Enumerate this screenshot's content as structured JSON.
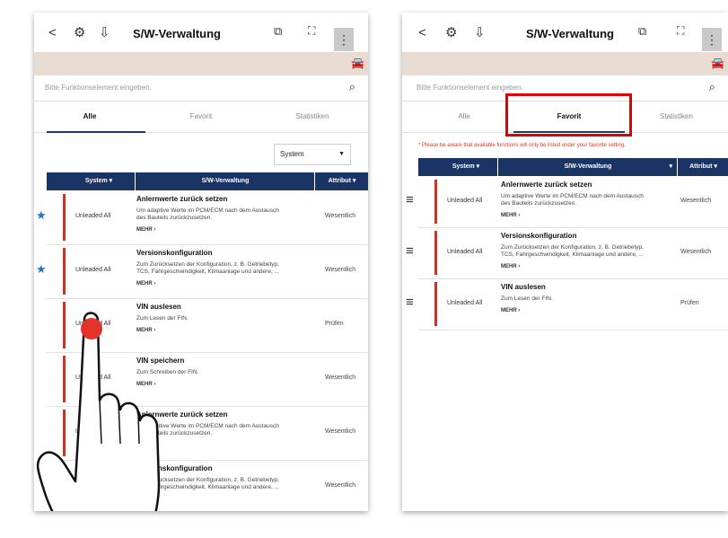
{
  "left": {
    "header": {
      "back": "<",
      "title": "S/W-Verwaltung",
      "menu": "⋮"
    },
    "search_placeholder": "Bitte Funktionselement eingeben.",
    "tabs": [
      "Alle",
      "Favorit",
      "Statistiken"
    ],
    "system_dropdown": "System",
    "table_headers": {
      "system": "System",
      "sw": "S/W-Verwaltung",
      "attr": "Attribut"
    },
    "rows": [
      {
        "system": "Unleaded All",
        "title": "Anlernwerte zurück setzen",
        "desc1": "Um adaptive Werte im PCM/ECM nach dem Austausch",
        "desc2": "des Bauteils zurückzusetzen.",
        "more": "MEHR ›",
        "attr": "Wesentlich",
        "star": true
      },
      {
        "system": "Unleaded All",
        "title": "Versionskonfiguration",
        "desc1": "Zum Zurücksetzen der Konfiguration, z. B. Getriebetyp,",
        "desc2": "TCS, Fahrgeschwindigkeit, Klimaanlage und andere, ...",
        "more": "MEHR ›",
        "attr": "Wesentlich",
        "star": true
      },
      {
        "system": "Unleaded All",
        "title": "VIN auslesen",
        "desc1": "Zum Lesen der FIN.",
        "desc2": "",
        "more": "MEHR ›",
        "attr": "Prüfen",
        "star": false
      },
      {
        "system": "Unleaded All",
        "title": "VIN speichern",
        "desc1": "Zum Schreiben der FIN.",
        "desc2": "",
        "more": "MEHR ›",
        "attr": "Wesentlich",
        "star": false
      },
      {
        "system": "Unleaded All",
        "title": "Anlernwerte zurück setzen",
        "desc1": "Um adaptive Werte im PCM/ECM nach dem Austausch",
        "desc2": "des Bauteils zurückzusetzen.",
        "more": "MEHR ›",
        "attr": "Wesentlich",
        "star": false
      },
      {
        "system": "Unleaded All",
        "title": "Versionskonfiguration",
        "desc1": "Zum Zurücksetzen der Konfiguration, z. B. Getriebetyp,",
        "desc2": "TCS, Fahrgeschwindigkeit, Klimaanlage und andere, ...",
        "more": "MEHR ›",
        "attr": "Wesentlich",
        "star": false
      }
    ]
  },
  "right": {
    "header": {
      "back": "<",
      "title": "S/W-Verwaltung",
      "menu": "⋮"
    },
    "search_placeholder": "Bitte Funktionselement eingeben.",
    "tabs": [
      "Alle",
      "Favorit",
      "Statistiken"
    ],
    "notice": "* Please be aware that available functions will only be listed under your favorite setting.",
    "table_headers": {
      "system": "System",
      "sw": "S/W-Verwaltung",
      "attr": "Attribut"
    },
    "rows": [
      {
        "system": "Unleaded All",
        "title": "Anlernwerte zurück setzen",
        "desc1": "Um adaptive Werte im PCM/ECM nach dem Austausch",
        "desc2": "des Bauteils zurückzusetzen.",
        "more": "MEHR ›",
        "attr": "Wesentlich"
      },
      {
        "system": "Unleaded All",
        "title": "Versionskonfiguration",
        "desc1": "Zum Zurücksetzen der Konfiguration, z. B. Getriebetyp,",
        "desc2": "TCS, Fahrgeschwindigkeit, Klimaanlage und andere, ...",
        "more": "MEHR ›",
        "attr": "Wesentlich"
      },
      {
        "system": "Unleaded All",
        "title": "VIN auslesen",
        "desc1": "Zum Lesen der FIN.",
        "desc2": "",
        "more": "MEHR ›",
        "attr": "Prüfen"
      }
    ]
  },
  "icons": {
    "gear": "gear-icon",
    "download": "download-icon",
    "export": "export-icon",
    "expand": "expand-icon",
    "car": "car-icon",
    "search": "search-icon",
    "star": "star-icon",
    "reorder": "reorder-icon",
    "hand": "hand-pointer-icon"
  },
  "colors": {
    "header_navy": "#1b3466",
    "accent_red": "#b93a2f",
    "highlight_box": "#e00000",
    "star_blue": "#1b75c9",
    "beige_bar": "#e8dcd2"
  }
}
